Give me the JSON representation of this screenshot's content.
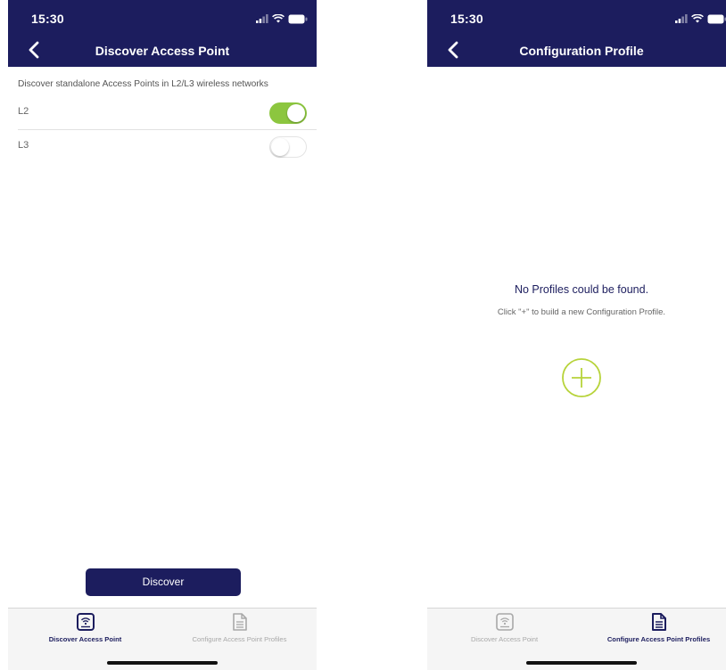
{
  "colors": {
    "primary": "#1c1d5e",
    "toggle_on": "#8cc63f",
    "add_accent": "#b7d33a",
    "inactive_tab": "#a8a8a8"
  },
  "discover_screen": {
    "status_time": "15:30",
    "title": "Discover Access Point",
    "description": "Discover standalone Access Points in L2/L3 wireless networks",
    "options": [
      {
        "label": "L2",
        "enabled": true
      },
      {
        "label": "L3",
        "enabled": false
      }
    ],
    "discover_button": "Discover",
    "tabs": [
      {
        "label": "Discover Access Point",
        "icon": "wifi-router-icon",
        "active": true
      },
      {
        "label": "Configure Access Point Profiles",
        "icon": "document-icon",
        "active": false
      }
    ]
  },
  "profile_screen": {
    "status_time": "15:30",
    "title": "Configuration Profile",
    "empty_title": "No Profiles could be found.",
    "empty_subtitle": "Click \"+\" to build a new Configuration Profile.",
    "add_icon": "plus-circle-icon",
    "tabs": [
      {
        "label": "Discover Access Point",
        "icon": "wifi-router-icon",
        "active": false
      },
      {
        "label": "Configure Access Point Profiles",
        "icon": "document-icon",
        "active": true
      }
    ]
  }
}
